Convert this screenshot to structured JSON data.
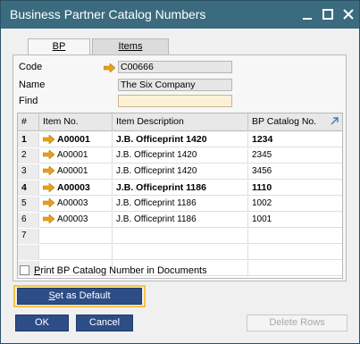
{
  "window": {
    "title": "Business Partner Catalog Numbers"
  },
  "tabs": [
    {
      "label": "BP",
      "active": true
    },
    {
      "label": "Items",
      "active": false
    }
  ],
  "fields": {
    "code": {
      "label": "Code",
      "value": "C00666"
    },
    "name": {
      "label": "Name",
      "value": "The Six Company"
    },
    "find": {
      "label": "Find",
      "value": ""
    }
  },
  "table": {
    "columns": [
      "#",
      "Item No.",
      "Item Description",
      "BP Catalog No."
    ],
    "rows": [
      {
        "num": "1",
        "item": "A00001",
        "desc": "J.B. Officeprint 1420",
        "bp": "1234",
        "bold": true
      },
      {
        "num": "2",
        "item": "A00001",
        "desc": "J.B. Officeprint 1420",
        "bp": "2345",
        "bold": false
      },
      {
        "num": "3",
        "item": "A00001",
        "desc": "J.B. Officeprint 1420",
        "bp": "3456",
        "bold": false
      },
      {
        "num": "4",
        "item": "A00003",
        "desc": "J.B. Officeprint 1186",
        "bp": "1110",
        "bold": true
      },
      {
        "num": "5",
        "item": "A00003",
        "desc": "J.B. Officeprint 1186",
        "bp": "1002",
        "bold": false
      },
      {
        "num": "6",
        "item": "A00003",
        "desc": "J.B. Officeprint 1186",
        "bp": "1001",
        "bold": false
      },
      {
        "num": "7",
        "item": "",
        "desc": "",
        "bp": "",
        "bold": false
      },
      {
        "num": "",
        "item": "",
        "desc": "",
        "bp": "",
        "bold": false
      },
      {
        "num": "",
        "item": "",
        "desc": "",
        "bp": "",
        "bold": false
      }
    ]
  },
  "options": {
    "print_bp_label": "Print BP Catalog Number in Documents",
    "print_bp_checked": false
  },
  "buttons": {
    "set_default": "Set as Default",
    "ok": "OK",
    "cancel": "Cancel",
    "delete_rows": "Delete Rows"
  },
  "colors": {
    "titlebar": "#3b6b7f",
    "primary_button": "#2c4d86",
    "link_arrow": "#e8a21a",
    "highlight": "#f4c542"
  },
  "icons": {
    "link_arrow": "orange-arrow-icon",
    "expand": "expand-icon",
    "minimize": "minimize-icon",
    "maximize": "maximize-icon",
    "close": "close-icon"
  }
}
